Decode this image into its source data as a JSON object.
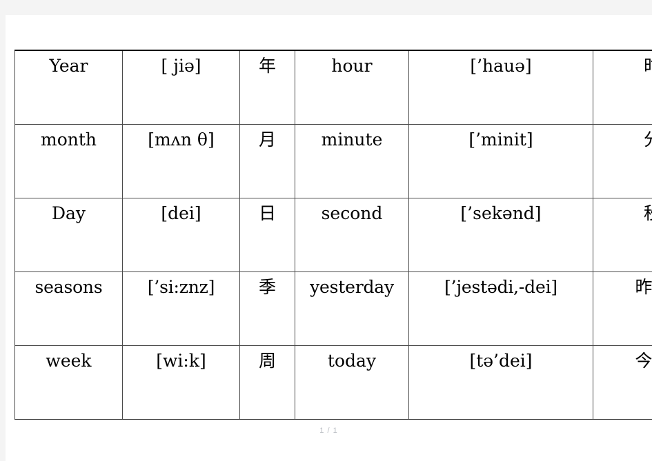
{
  "document": {
    "footer_label": "1 / 1",
    "background_color": "#f4f4f4",
    "page_color": "#ffffff",
    "border_color": "#4a4a4a"
  },
  "table": {
    "columns": [
      "english-left",
      "phonetic-left",
      "chinese-left",
      "english-right",
      "phonetic-right",
      "chinese-right"
    ],
    "rows": [
      {
        "en1": "Year",
        "ipa1": "[ jiә]",
        "cn1": "年",
        "en2": "hour",
        "ipa2": "[’hauә]",
        "cn2": "时"
      },
      {
        "en1": "month",
        "ipa1": "[mʌn θ]",
        "cn1": "月",
        "en2": "minute",
        "ipa2": "[’minit]",
        "cn2": "分"
      },
      {
        "en1": "Day",
        "ipa1": "[dei]",
        "cn1": "日",
        "en2": "second",
        "ipa2": "[’sekәnd]",
        "cn2": "秒"
      },
      {
        "en1": "seasons",
        "ipa1": "[’si:znz]",
        "cn1": "季",
        "en2": "yesterday",
        "ipa2": "[’jestәdi,-dei]",
        "cn2": "昨天"
      },
      {
        "en1": "week",
        "ipa1": "[wi:k]",
        "cn1": "周",
        "en2": "today",
        "ipa2": "[tә’dei]",
        "cn2": "今天"
      }
    ]
  }
}
